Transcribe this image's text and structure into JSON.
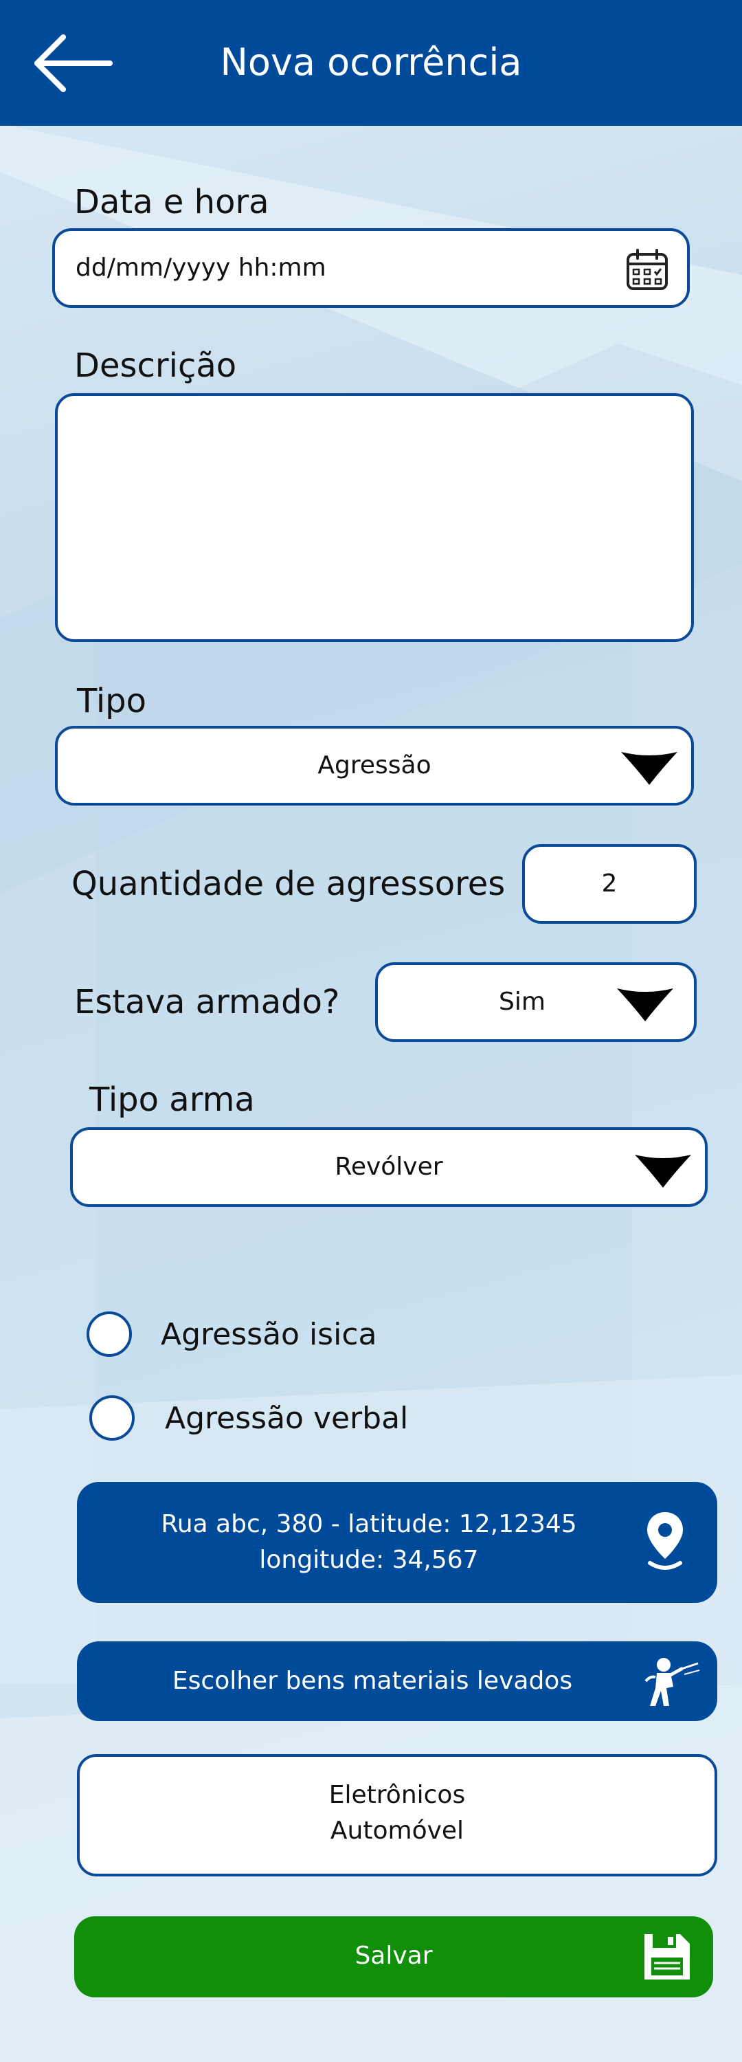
{
  "header": {
    "title": "Nova ocorrência",
    "back_icon": "arrow-left-icon"
  },
  "form": {
    "datetime": {
      "label": "Data e hora",
      "placeholder": "dd/mm/yyyy hh:mm",
      "icon": "calendar-icon"
    },
    "description": {
      "label": "Descrição",
      "value": ""
    },
    "tipo": {
      "label": "Tipo",
      "selected": "Agressão"
    },
    "agressores": {
      "label": "Quantidade de agressores",
      "value": "2"
    },
    "armado": {
      "label": "Estava armado?",
      "selected": "Sim"
    },
    "tipo_arma": {
      "label": "Tipo arma",
      "selected": "Revólver"
    },
    "radios": [
      {
        "label": "Agressão isica"
      },
      {
        "label": "Agressão verbal"
      }
    ],
    "location": {
      "line1": "Rua abc, 380 - latitude: 12,12345",
      "line2": "longitude: 34,567",
      "icon": "location-pin-icon"
    },
    "bens_button": {
      "label": "Escolher bens materiais levados",
      "icon": "thief-icon"
    },
    "bens_list": {
      "line1": "Eletrônicos",
      "line2": "Automóvel"
    },
    "save_button": {
      "label": "Salvar",
      "icon": "floppy-disk-icon"
    }
  },
  "colors": {
    "header": "#004a9a",
    "border": "#0a4a99",
    "save": "#118f0a"
  }
}
